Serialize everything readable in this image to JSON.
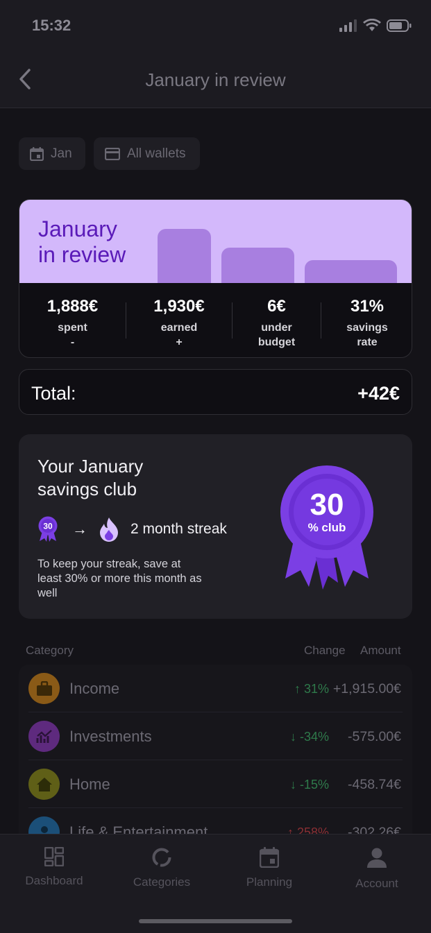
{
  "status_bar": {
    "time": "15:32"
  },
  "header": {
    "title": "January in review"
  },
  "filters": [
    {
      "label": "Jan",
      "icon": "calendar-icon"
    },
    {
      "label": "All wallets",
      "icon": "wallet-icon"
    }
  ],
  "review_card": {
    "title_line1": "January",
    "title_line2": "in review",
    "stats": [
      {
        "value": "1,888€",
        "label_line1": "spent",
        "label_line2": "-"
      },
      {
        "value": "1,930€",
        "label_line1": "earned",
        "label_line2": "+"
      },
      {
        "value": "6€",
        "label_line1": "under",
        "label_line2": "budget"
      },
      {
        "value": "31%",
        "label_line1": "savings",
        "label_line2": "rate"
      }
    ]
  },
  "total": {
    "label": "Total:",
    "value": "+42€"
  },
  "savings_club": {
    "title_line1": "Your January",
    "title_line2": "savings club",
    "small_badge_number": "30",
    "arrow": "→",
    "streak_text": "2 month streak",
    "note": "To keep your streak, save at least 30% or more this month as well",
    "badge_number": "30",
    "badge_label": "% club"
  },
  "category_table": {
    "headers": {
      "category": "Category",
      "change": "Change",
      "amount": "Amount"
    },
    "rows": [
      {
        "name": "Income",
        "arrow": "↑",
        "change": "31%",
        "amount": "+1,915.00€",
        "icon": "briefcase-icon",
        "icon_color": "#8a5a17"
      },
      {
        "name": "Investments",
        "arrow": "↓",
        "change": "-34%",
        "amount": "-575.00€",
        "icon": "chart-icon",
        "icon_color": "#5e2a7e"
      },
      {
        "name": "Home",
        "arrow": "↓",
        "change": "-15%",
        "amount": "-458.74€",
        "icon": "home-icon",
        "icon_color": "#5f5f17"
      },
      {
        "name": "Life & Entertainment",
        "arrow": "↑",
        "change": "258%",
        "amount": "-302.26€",
        "icon": "person-icon",
        "icon_color": "#1b4f78"
      }
    ]
  },
  "bottom_nav": [
    {
      "label": "Dashboard",
      "icon": "dashboard-icon"
    },
    {
      "label": "Categories",
      "icon": "categories-icon"
    },
    {
      "label": "Planning",
      "icon": "planning-icon"
    },
    {
      "label": "Account",
      "icon": "account-icon"
    }
  ],
  "colors": {
    "background": "#141318",
    "banner": "#d3b8fb",
    "banner_text": "#5a1ab8",
    "badge_purple": "#7b3fe4"
  }
}
